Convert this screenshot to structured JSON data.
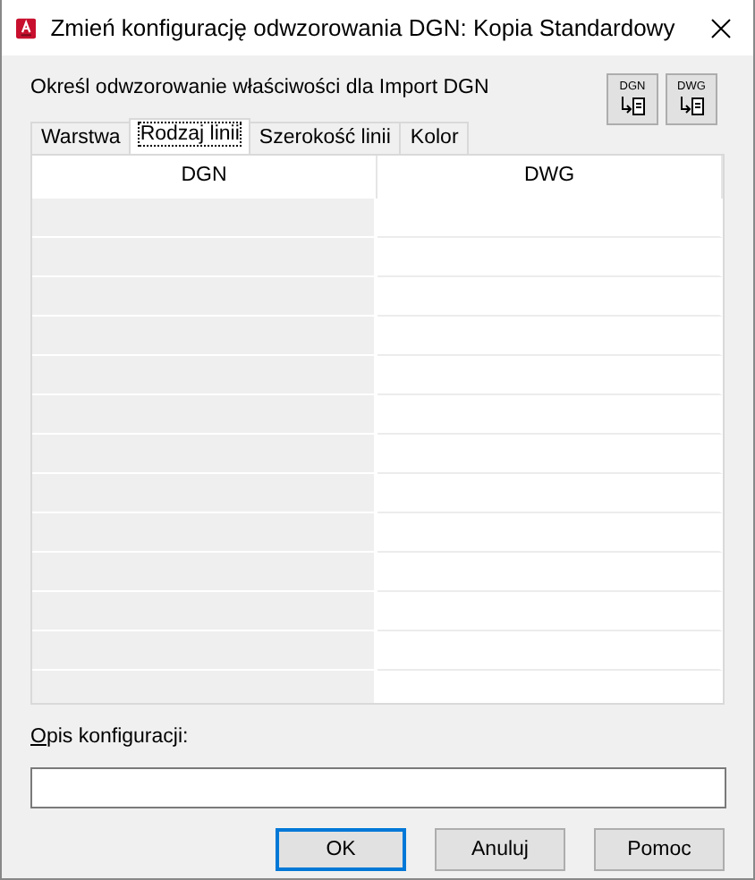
{
  "window": {
    "title": "Zmień konfigurację odwzorowania DGN: Kopia Standardowy"
  },
  "instruction": "Określ odwzorowanie właściwości dla Import DGN",
  "tool_buttons": [
    {
      "label": "DGN"
    },
    {
      "label": "DWG"
    }
  ],
  "tabs": [
    {
      "label": "Warstwa",
      "selected": false
    },
    {
      "label": "Rodzaj linii",
      "selected": true
    },
    {
      "label": "Szerokość linii",
      "selected": false
    },
    {
      "label": "Kolor",
      "selected": false
    }
  ],
  "table": {
    "columns": [
      "DGN",
      "DWG"
    ]
  },
  "description": {
    "label": "Opis konfiguracji:"
  },
  "buttons": [
    {
      "label": "OK",
      "default": true
    },
    {
      "label": "Anuluj",
      "default": false
    },
    {
      "label": "Pomoc",
      "default": false
    }
  ]
}
